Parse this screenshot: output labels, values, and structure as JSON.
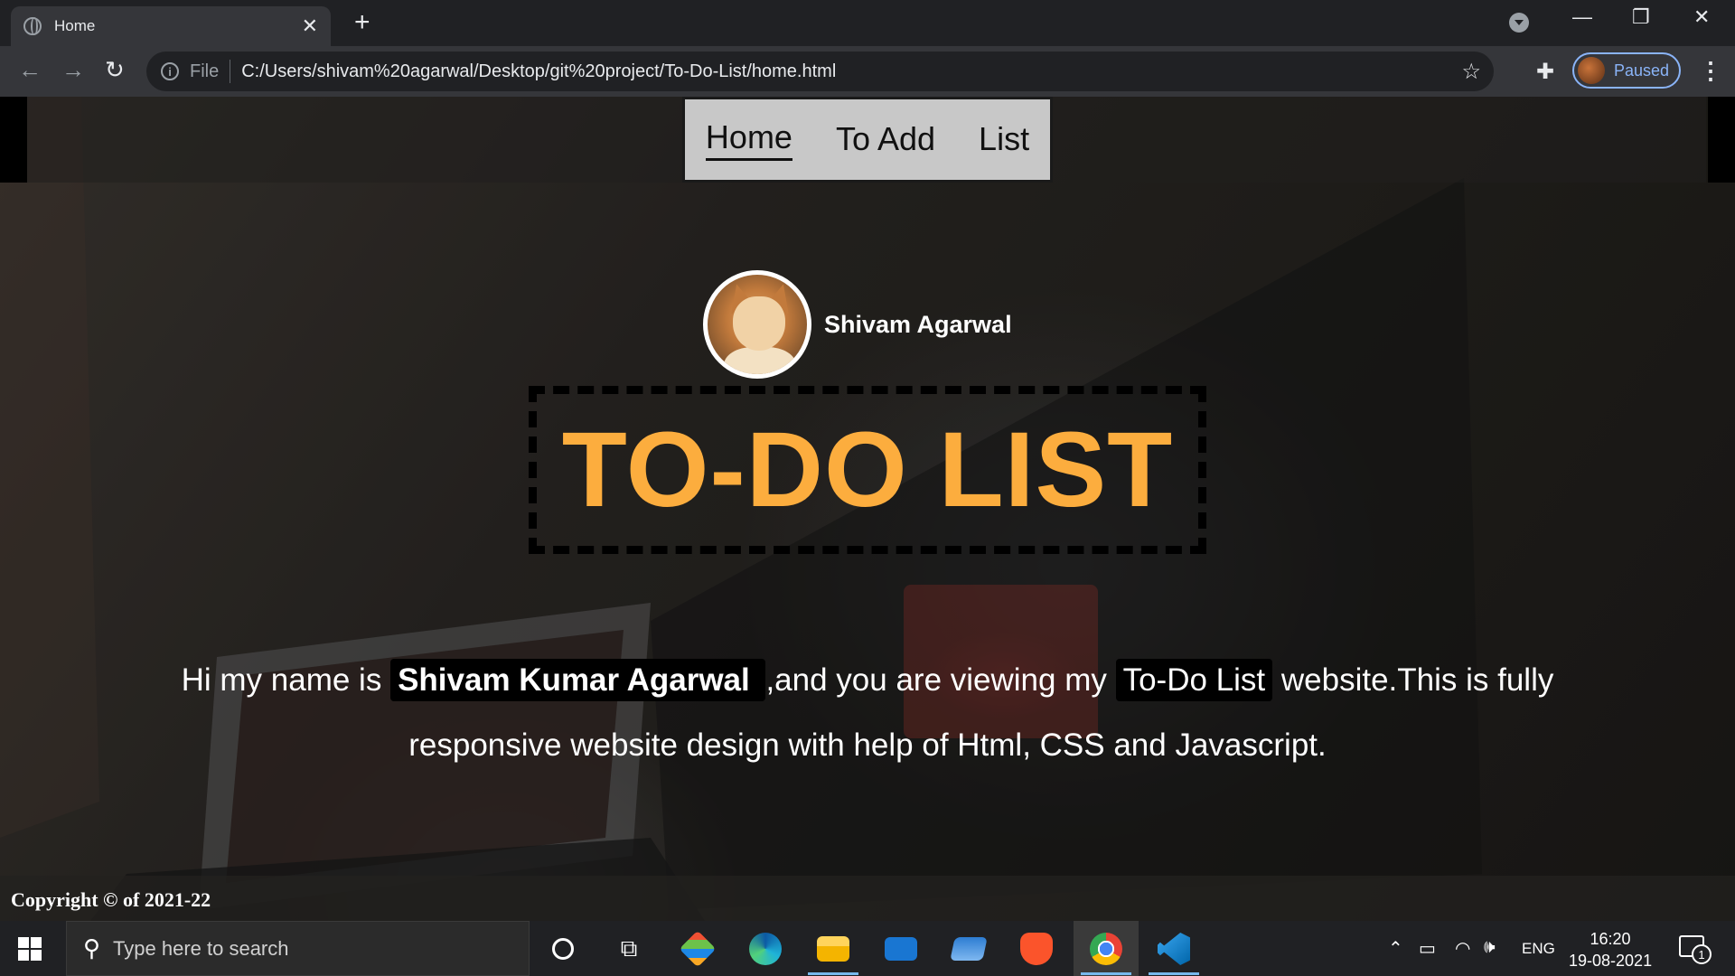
{
  "browser": {
    "tab_title": "Home",
    "tab_close": "✕",
    "new_tab": "+",
    "file_label": "File",
    "url": "C:/Users/shivam%20agarwal/Desktop/git%20project/To-Do-List/home.html",
    "profile_status": "Paused",
    "window_controls": {
      "minimize": "—",
      "restore": "❐",
      "close": "✕"
    }
  },
  "site": {
    "nav": {
      "home": "Home",
      "add": "To Add",
      "list": "List"
    },
    "profile_name": "Shivam Agarwal",
    "title": "TO-DO LIST",
    "intro": {
      "part1": "Hi my name is ",
      "name": "Shivam Kumar Agarwal ",
      "part2": ",and you are viewing my ",
      "site_name": "To-Do List",
      "part3": " website.This is fully responsive website design with help of Html, CSS and Javascript."
    },
    "footer": "Copyright © of 2021-22"
  },
  "taskbar": {
    "search_placeholder": "Type here to search",
    "apps": [
      "cortana-icon",
      "task-view-icon",
      "git-icon",
      "edge-icon",
      "file-explorer-icon",
      "mail-icon",
      "remote-desktop-icon",
      "brave-icon",
      "chrome-icon",
      "vscode-icon"
    ],
    "language": "ENG",
    "time": "16:20",
    "date": "19-08-2021",
    "notification_count": "1"
  }
}
